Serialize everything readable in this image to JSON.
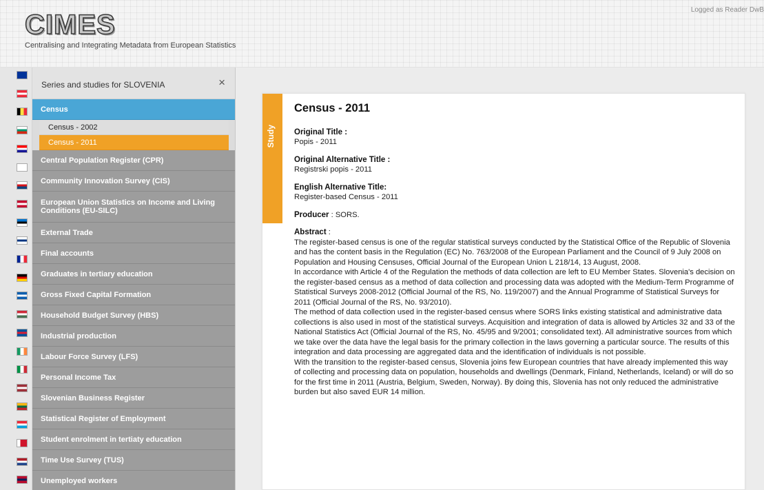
{
  "header": {
    "logo": "CIMES",
    "tagline": "Centralising and Integrating Metadata from European Statistics",
    "login": "Logged as Reader DwB"
  },
  "flags": [
    {
      "name": "eu",
      "colors": [
        "#003399",
        "#003399",
        "#003399"
      ]
    },
    {
      "name": "austria",
      "colors": [
        "#ed2939",
        "#ffffff",
        "#ed2939"
      ]
    },
    {
      "name": "belgium",
      "colors": [
        "#000000",
        "#fae042",
        "#ed2939"
      ],
      "vertical": true
    },
    {
      "name": "bulgaria",
      "colors": [
        "#ffffff",
        "#00966e",
        "#d62612"
      ]
    },
    {
      "name": "croatia",
      "colors": [
        "#ff0000",
        "#ffffff",
        "#171796"
      ]
    },
    {
      "name": "cyprus",
      "colors": [
        "#ffffff",
        "#ffffff",
        "#ffffff"
      ]
    },
    {
      "name": "czech",
      "colors": [
        "#ffffff",
        "#d7141a",
        "#11457e"
      ]
    },
    {
      "name": "denmark",
      "colors": [
        "#c60c30",
        "#ffffff",
        "#c60c30"
      ]
    },
    {
      "name": "estonia",
      "colors": [
        "#0072ce",
        "#000000",
        "#ffffff"
      ]
    },
    {
      "name": "finland",
      "colors": [
        "#ffffff",
        "#003580",
        "#ffffff"
      ]
    },
    {
      "name": "france",
      "colors": [
        "#002395",
        "#ffffff",
        "#ed2939"
      ],
      "vertical": true
    },
    {
      "name": "germany",
      "colors": [
        "#000000",
        "#dd0000",
        "#ffce00"
      ]
    },
    {
      "name": "greece",
      "colors": [
        "#0d5eaf",
        "#ffffff",
        "#0d5eaf"
      ]
    },
    {
      "name": "hungary",
      "colors": [
        "#ce2939",
        "#ffffff",
        "#477050"
      ]
    },
    {
      "name": "iceland",
      "colors": [
        "#02529c",
        "#dc1e35",
        "#02529c"
      ]
    },
    {
      "name": "ireland",
      "colors": [
        "#169b62",
        "#ffffff",
        "#ff883e"
      ],
      "vertical": true
    },
    {
      "name": "italy",
      "colors": [
        "#009246",
        "#ffffff",
        "#ce2b37"
      ],
      "vertical": true
    },
    {
      "name": "latvia",
      "colors": [
        "#9e3039",
        "#ffffff",
        "#9e3039"
      ]
    },
    {
      "name": "lithuania",
      "colors": [
        "#fdb913",
        "#006a44",
        "#c1272d"
      ]
    },
    {
      "name": "luxembourg",
      "colors": [
        "#ed2939",
        "#ffffff",
        "#00a1de"
      ]
    },
    {
      "name": "malta",
      "colors": [
        "#ffffff",
        "#cf142b",
        "#cf142b"
      ],
      "vertical": true
    },
    {
      "name": "netherlands",
      "colors": [
        "#ae1c28",
        "#ffffff",
        "#21468b"
      ]
    },
    {
      "name": "norway",
      "colors": [
        "#ba0c2f",
        "#00205b",
        "#ba0c2f"
      ]
    }
  ],
  "panel": {
    "title": "Series and studies for SLOVENIA",
    "close_glyph": "×",
    "series": [
      {
        "label": "Census",
        "active": true,
        "studies": [
          {
            "label": "Census - 2002",
            "active": false
          },
          {
            "label": "Census - 2011",
            "active": true
          }
        ]
      },
      {
        "label": "Central Population Register (CPR)"
      },
      {
        "label": "Community Innovation Survey (CIS)"
      },
      {
        "label": "European Union Statistics on Income and Living Conditions (EU-SILC)"
      },
      {
        "label": "External Trade"
      },
      {
        "label": "Final accounts"
      },
      {
        "label": "Graduates in tertiary education"
      },
      {
        "label": "Gross Fixed Capital Formation"
      },
      {
        "label": "Household Budget Survey (HBS)"
      },
      {
        "label": "Industrial production"
      },
      {
        "label": "Labour Force Survey (LFS)"
      },
      {
        "label": "Personal Income Tax"
      },
      {
        "label": "Slovenian Business Register"
      },
      {
        "label": "Statistical Register of Employment"
      },
      {
        "label": "Student enrolment in tertiaty education"
      },
      {
        "label": "Time Use Survey (TUS)"
      },
      {
        "label": "Unemployed workers"
      }
    ]
  },
  "study": {
    "tab_label": "Study",
    "title": "Census - 2011",
    "original_title_label": "Original Title :",
    "original_title": "Popis - 2011",
    "original_alt_label": "Original Alternative Title :",
    "original_alt": "Registrski popis - 2011",
    "english_alt_label": "English Alternative Title:",
    "english_alt": "Register-based Census - 2011",
    "producer_label": "Producer",
    "producer": " : SORS.",
    "abstract_label": "Abstract",
    "abstract_sep": " :",
    "abstract_paragraphs": [
      "The register-based census is one of the regular statistical surveys conducted by the Statistical Office of the Republic of Slovenia and has the content basis in the Regulation (EC) No. 763/2008 of the European Parliament and the Council of 9 July 2008 on Population and Housing Censuses, Official Journal of the European Union L 218/14, 13 August, 2008.",
      "In accordance with Article 4 of the Regulation the methods of data collection are left to EU Member States. Slovenia's decision on the register-based census as a method of data collection and processing data was adopted with the Medium-Term Programme of Statistical Surveys 2008-2012 (Official Journal of the RS, No. 119/2007) and the Annual Programme of Statistical Surveys for 2011 (Official Journal of the RS, No. 93/2010).",
      "The method of data collection used in the register-based census where SORS links existing statistical and administrative data collections is also used in most of the statistical surveys. Acquisition and integration of data is allowed by Articles 32 and 33 of the National Statistics Act (Official Journal of the RS, No. 45/95 and 9/2001; consolidated text). All administrative sources from which we take over the data have the legal basis for the primary collection in the laws governing a particular source. The results of this integration and data processing are aggregated data and the identification of individuals is not possible.",
      "With the transition to the register-based census, Slovenia joins few European countries that have already implemented this way of collecting and processing data on population, households and dwellings (Denmark, Finland, Netherlands, Iceland) or will do so for the first time in 2011 (Austria, Belgium, Sweden, Norway). By doing this, Slovenia has not only reduced the administrative burden but also saved EUR 14 million."
    ]
  },
  "colors": {
    "accent_orange": "#f0a126",
    "accent_blue": "#4aa6d6",
    "series_gray": "#9d9d9d"
  }
}
